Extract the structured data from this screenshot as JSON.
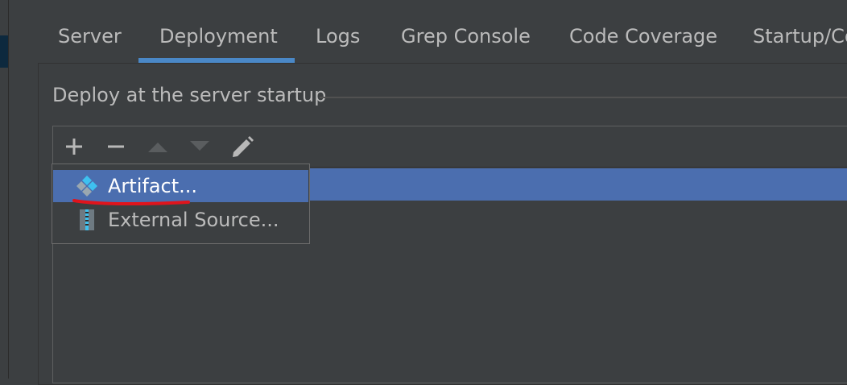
{
  "tabs": [
    {
      "label": "Server"
    },
    {
      "label": "Deployment"
    },
    {
      "label": "Logs"
    },
    {
      "label": "Grep Console"
    },
    {
      "label": "Code Coverage"
    },
    {
      "label": "Startup/Co"
    }
  ],
  "active_tab": "Deployment",
  "deploy": {
    "section_title": "Deploy at the server startup"
  },
  "toolbar": {
    "icons": [
      "plus-icon",
      "minus-icon",
      "move-up-icon",
      "move-down-icon",
      "edit-pencil-icon"
    ]
  },
  "popup": {
    "items": [
      {
        "label": "Artifact...",
        "icon": "artifact-icon"
      },
      {
        "label": "External Source...",
        "icon": "archive-icon"
      }
    ]
  },
  "colors": {
    "background": "#3c3f41",
    "selection": "#4b6eaf",
    "tab_underline": "#4a88c7",
    "annotation": "#e0141c"
  }
}
